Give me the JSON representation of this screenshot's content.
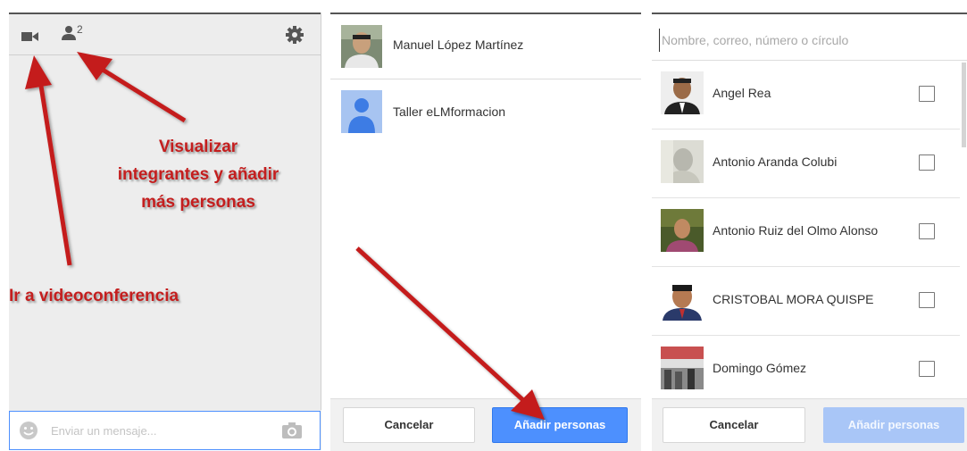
{
  "hangout": {
    "participant_count": "2",
    "message_placeholder": "Enviar un mensaje...",
    "annotation_people": "Visualizar integrantes y añadir más personas",
    "annotation_people_lines": [
      "Visualizar",
      "integrantes y añadir",
      "más personas"
    ],
    "annotation_video": "Ir a videoconferencia",
    "icons": [
      "video-camera-icon",
      "people-icon",
      "gear-icon",
      "smiley-icon",
      "camera-icon"
    ]
  },
  "members": {
    "items": [
      {
        "name": "Manuel López Martínez"
      },
      {
        "name": "Taller eLMformacion"
      }
    ],
    "cancel_label": "Cancelar",
    "add_label": "Añadir personas"
  },
  "picker": {
    "search_placeholder": "Nombre, correo, número o círculo",
    "contacts": [
      {
        "name": "Angel Rea"
      },
      {
        "name": "Antonio Aranda Colubi"
      },
      {
        "name": "Antonio Ruiz del Olmo Alonso"
      },
      {
        "name": "CRISTOBAL MORA QUISPE"
      },
      {
        "name": "Domingo Gómez"
      }
    ],
    "cancel_label": "Cancelar",
    "add_label": "Añadir personas"
  },
  "colors": {
    "accent_blue": "#4d90fe",
    "annotation_red": "#c41e1e",
    "panel_gray": "#ededed"
  }
}
